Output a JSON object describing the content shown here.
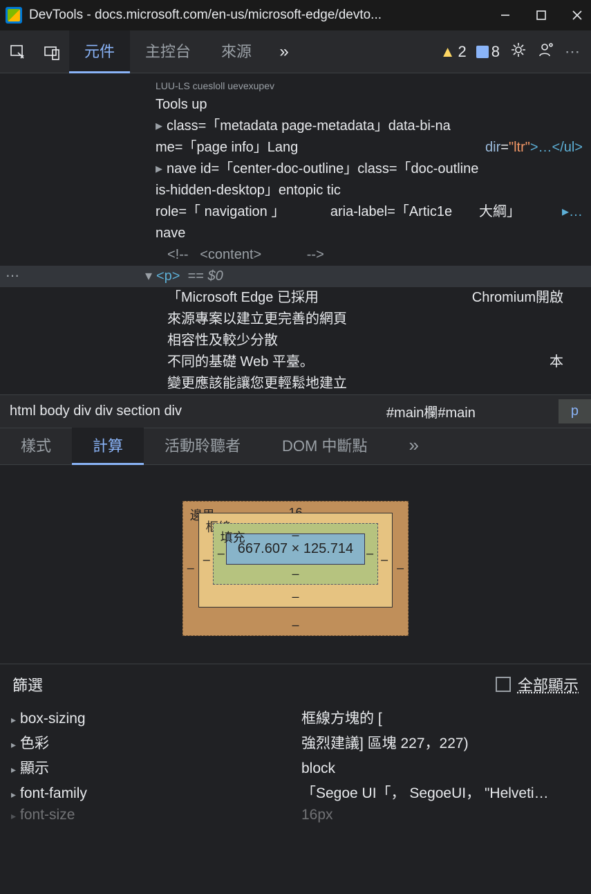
{
  "titlebar": {
    "title": "DevTools - docs.microsoft.com/en-us/microsoft-edge/devto..."
  },
  "toolbar": {
    "tabs": {
      "elements": "元件",
      "console": "主控台",
      "sources": "來源"
    },
    "warn_count": "2",
    "error_count": "8"
  },
  "dom": {
    "caption": "LUU-LS cuesloll uevexupev",
    "tools": "Tools up",
    "line1a": "class=「metadata page-metadata」data-bi-na",
    "line1b": "me=「page info」Lang",
    "dir_attr": "dir",
    "dir_val": "\"ltr\"",
    "dir_tail": ">…</ul>",
    "line2a": "nave id=「center-doc-outline」class=「doc-outline",
    "line2b": "is-hidden-desktop」entopic tic",
    "line2c_role": "role=「 navigation 」",
    "line2c_aria": "aria-label=「Artic1e",
    "line2c_outline": "大綱」",
    "line2c_more": "▸…",
    "line2d": "nave",
    "comment_open": "<!--",
    "comment_mid": "<content>",
    "comment_close": "-->",
    "p_open": "<p>",
    "p_eq": "==",
    "p_dollar": "$0",
    "text1": "「Microsoft       Edge 已採用",
    "text1r": "Chromium開啟",
    "text2": "來源專案以建立更完善的網頁",
    "text3": "相容性及較少分散",
    "text4": "不同的基礎 Web 平臺。",
    "text4r": "本",
    "text5": "變更應該能讓您更輕鬆地建立"
  },
  "breadcrumb": {
    "path": "html body div div section div",
    "hash": "#main欄#main",
    "current": "p"
  },
  "subtabs": {
    "styles": "樣式",
    "computed": "計算",
    "listeners": "活動聆聽者",
    "dom_bp": "DOM 中斷點"
  },
  "boxmodel": {
    "margin_label": "邊界",
    "margin_top": "16",
    "border_label": "框線",
    "padding_label": "填充",
    "dash": "–",
    "content": "667.607 × 125.714"
  },
  "filter": {
    "label": "篩選",
    "showall": "全部顯示"
  },
  "props": {
    "r1n": "box-sizing",
    "r1v": "框線方塊的 [",
    "r2n": "色彩",
    "r2v": "強烈建議] 區塊 227，227)",
    "r3n": "顯示",
    "r3v": "block",
    "r4n": "font-family",
    "r4v": "「Segoe   UI「，  SegoeUI， \"Helveti…",
    "r5n": "font-size",
    "r5v": "16px"
  }
}
